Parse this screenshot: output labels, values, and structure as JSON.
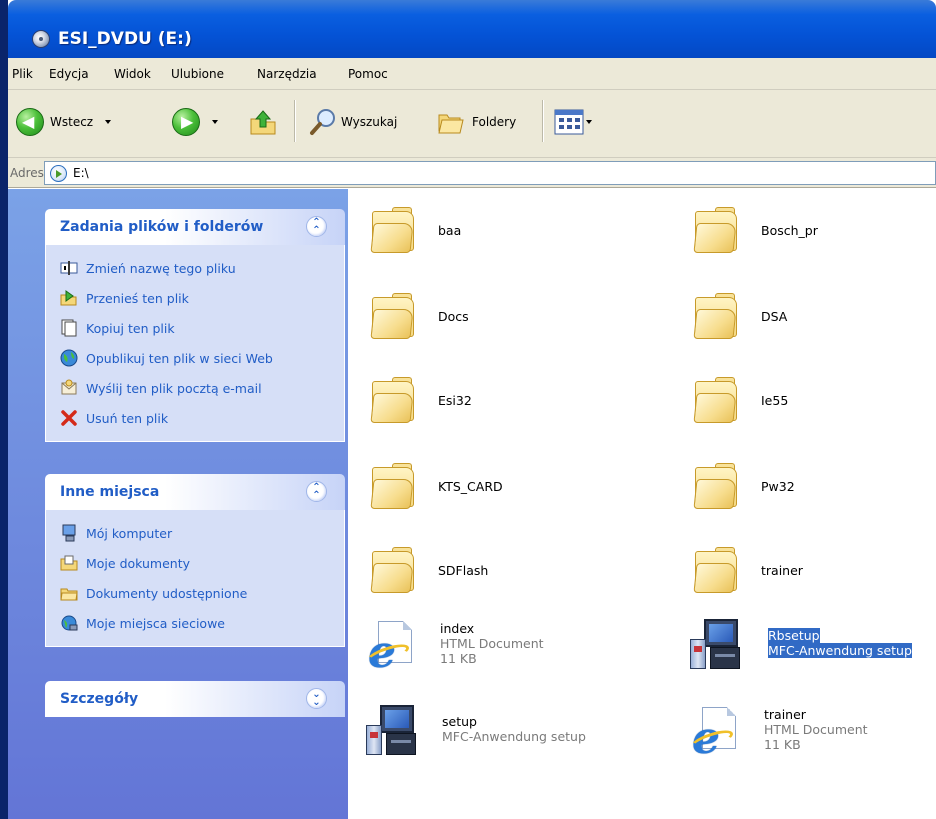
{
  "window": {
    "title": "ESI_DVDU (E:)"
  },
  "menu": [
    "Plik",
    "Edycja",
    "Widok",
    "Ulubione",
    "Narzędzia",
    "Pomoc"
  ],
  "toolbar": {
    "back_label": "Wstecz",
    "search_label": "Wyszukaj",
    "folders_label": "Foldery"
  },
  "address": {
    "label": "Adres",
    "value": "E:\\"
  },
  "sidebar": {
    "file_tasks": {
      "title": "Zadania plików i folderów",
      "items": [
        {
          "label": "Zmień nazwę tego pliku",
          "icon": "rename-icon"
        },
        {
          "label": "Przenieś ten plik",
          "icon": "move-icon"
        },
        {
          "label": "Kopiuj ten plik",
          "icon": "copy-icon"
        },
        {
          "label": "Opublikuj ten plik w sieci Web",
          "icon": "publish-web-icon"
        },
        {
          "label": "Wyślij ten plik pocztą e-mail",
          "icon": "email-icon"
        },
        {
          "label": "Usuń ten plik",
          "icon": "delete-icon"
        }
      ]
    },
    "other_places": {
      "title": "Inne miejsca",
      "items": [
        {
          "label": "Mój komputer",
          "icon": "my-computer-icon"
        },
        {
          "label": "Moje dokumenty",
          "icon": "my-documents-icon"
        },
        {
          "label": "Dokumenty udostępnione",
          "icon": "shared-folder-icon"
        },
        {
          "label": "Moje miejsca sieciowe",
          "icon": "network-places-icon"
        }
      ]
    },
    "details": {
      "title": "Szczegóły"
    }
  },
  "files": [
    {
      "name": "baa",
      "type": "folder"
    },
    {
      "name": "Bosch_pr",
      "type": "folder"
    },
    {
      "name": "Docs",
      "type": "folder"
    },
    {
      "name": "DSA",
      "type": "folder"
    },
    {
      "name": "Esi32",
      "type": "folder"
    },
    {
      "name": "Ie55",
      "type": "folder"
    },
    {
      "name": "KTS_CARD",
      "type": "folder"
    },
    {
      "name": "Pw32",
      "type": "folder"
    },
    {
      "name": "SDFlash",
      "type": "folder"
    },
    {
      "name": "trainer",
      "type": "folder"
    },
    {
      "name": "index",
      "type": "html",
      "desc": "HTML Document",
      "size": "11 KB"
    },
    {
      "name": "Rbsetup",
      "type": "setup",
      "desc": "MFC-Anwendung setup",
      "selected": true
    },
    {
      "name": "setup",
      "type": "setup",
      "desc": "MFC-Anwendung setup"
    },
    {
      "name": "trainer",
      "type": "html",
      "desc": "HTML Document",
      "size": "11 KB"
    }
  ]
}
